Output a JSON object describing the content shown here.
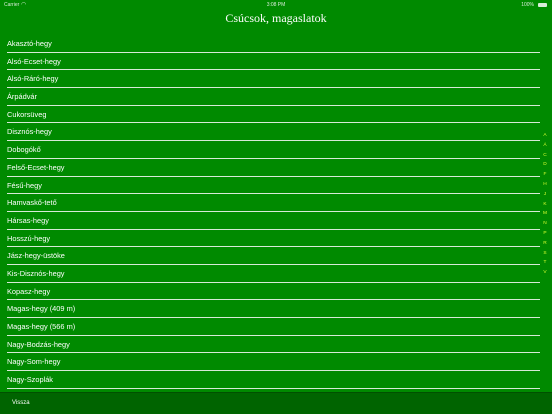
{
  "status_bar": {
    "carrier": "Carrier",
    "wifi_icon": "wifi-icon",
    "time": "3:08 PM",
    "battery_text": "100%",
    "battery_icon": "battery-icon"
  },
  "header": {
    "title": "Csúcsok, magaslatok"
  },
  "list": {
    "items": [
      "Akasztó-hegy",
      "Alsó-Ecset-hegy",
      "Alsó-Ráró-hegy",
      "Árpádvár",
      "Cukorsüveg",
      "Disznós-hegy",
      "Dobogókő",
      "Felső-Ecset-hegy",
      "Fésű-hegy",
      "Hamvaskő-tető",
      "Hársas-hegy",
      "Hosszú-hegy",
      "Jász-hegy-üstöke",
      "Kis-Disznós-hegy",
      "Kopasz-hegy",
      "Magas-hegy (409 m)",
      "Magas-hegy (566 m)",
      "Nagy-Bodzás-hegy",
      "Nagy-Som-hegy",
      "Nagy-Szoplák"
    ]
  },
  "section_index": {
    "letters": [
      "A",
      "Á",
      "C",
      "D",
      "F",
      "H",
      "J",
      "K",
      "M",
      "N",
      "P",
      "R",
      "S",
      "T",
      "V"
    ]
  },
  "toolbar": {
    "back_label": "Vissza"
  },
  "colors": {
    "background": "#008a00",
    "toolbar": "#006400",
    "index_text": "#d8ff30",
    "separator": "#d6ead6"
  }
}
